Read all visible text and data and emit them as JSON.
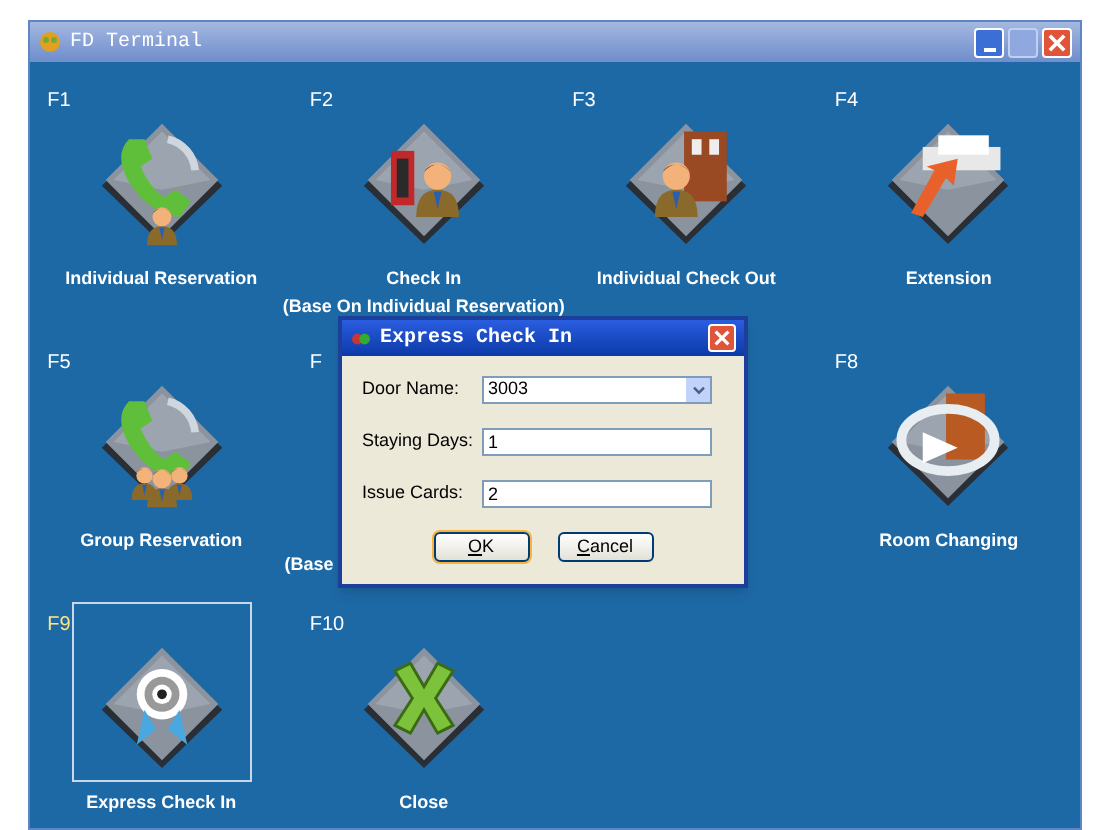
{
  "window": {
    "title": "FD Terminal"
  },
  "tiles": [
    {
      "key": "F1",
      "kind": "phone",
      "label": "Individual Reservation",
      "selected": false
    },
    {
      "key": "F2",
      "kind": "checkin",
      "label": "Check In",
      "sublabel": "(Base On Individual Reservation)",
      "selected": false
    },
    {
      "key": "F3",
      "kind": "checkout",
      "label": "Individual Check Out",
      "selected": false
    },
    {
      "key": "F4",
      "kind": "extension",
      "label": "Extension",
      "selected": false
    },
    {
      "key": "F5",
      "kind": "group",
      "label": "Group Reservation",
      "selected": false
    },
    {
      "key": "F",
      "kind": "hidden",
      "sublabel": "(Base",
      "selected": false
    },
    {
      "kind": "empty"
    },
    {
      "key": "F8",
      "kind": "roomchange",
      "label": "Room Changing",
      "selected": false
    },
    {
      "key": "F9",
      "kind": "target",
      "label": "Express Check In",
      "selected": true
    },
    {
      "key": "F10",
      "kind": "close",
      "label": "Close",
      "selected": false
    }
  ],
  "dialog": {
    "title": "Express Check In",
    "fields": [
      {
        "kind": "select",
        "label": "Door Name:",
        "value": "3003"
      },
      {
        "kind": "text",
        "label": "Staying Days:",
        "value": "1"
      },
      {
        "kind": "text",
        "label": "Issue Cards:",
        "value": "2"
      }
    ],
    "buttons": [
      {
        "mnemonic": "O",
        "rest": "K",
        "focused": true
      },
      {
        "mnemonic": "C",
        "rest": "ancel",
        "focused": false
      }
    ]
  }
}
